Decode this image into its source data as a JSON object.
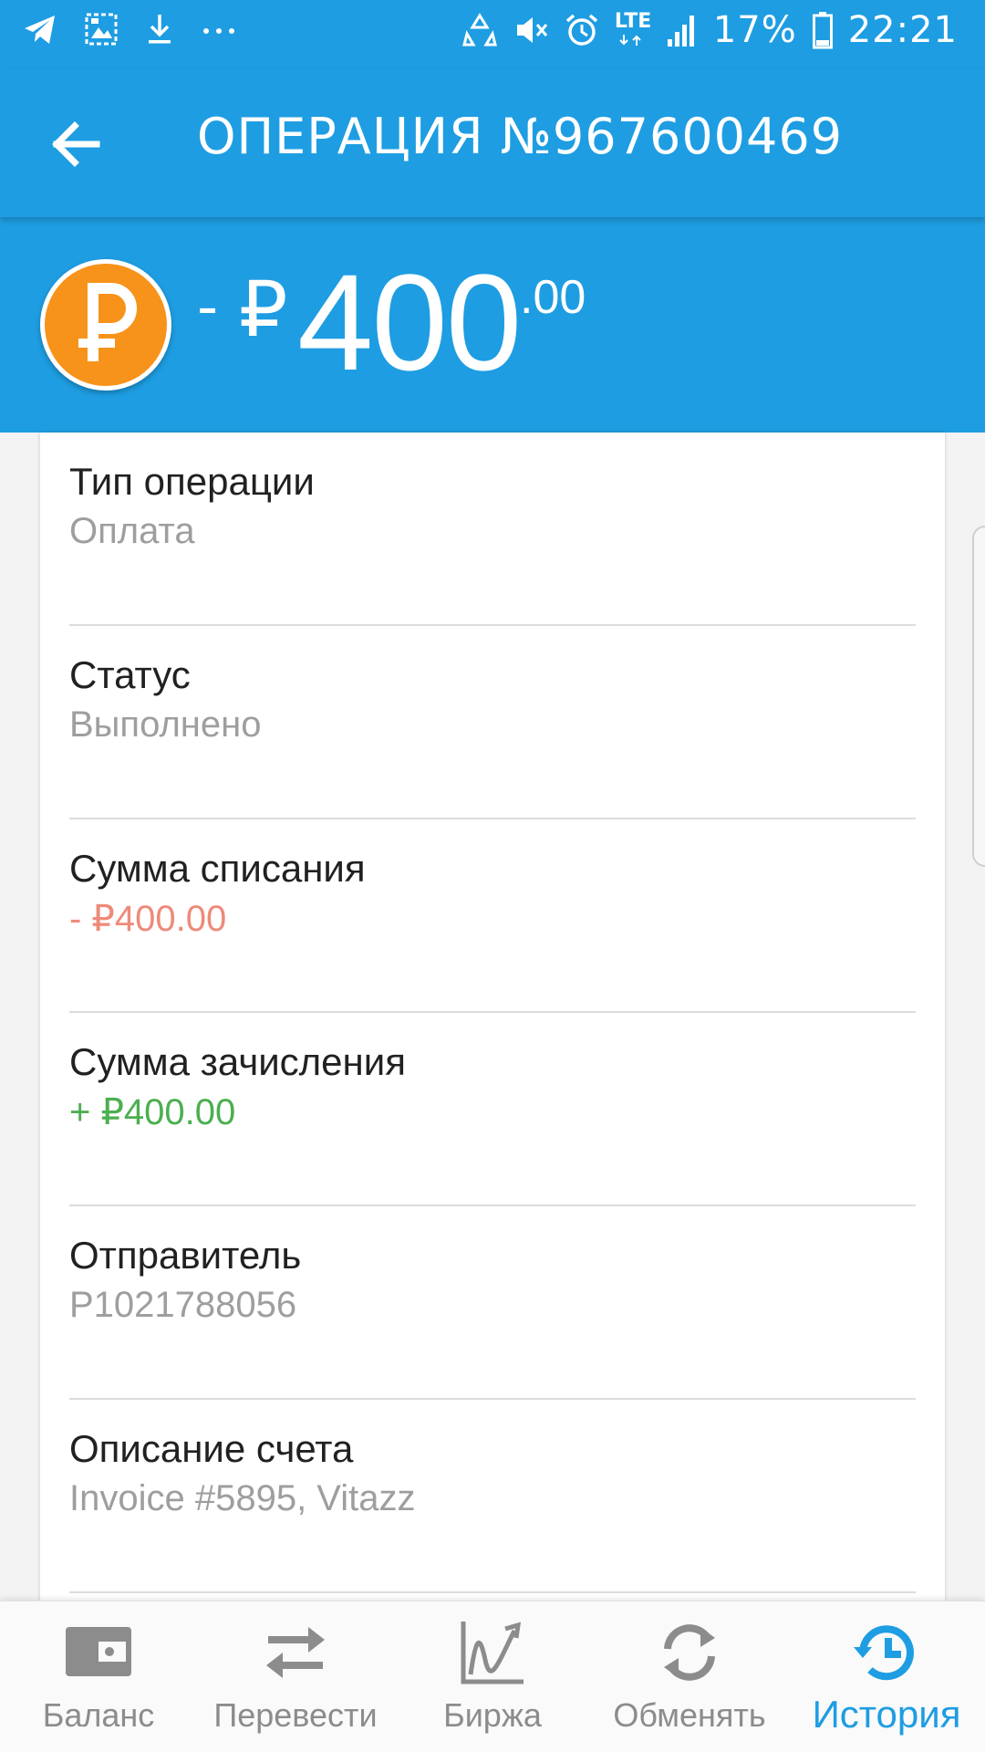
{
  "status_bar": {
    "left_icons": [
      "telegram-icon",
      "gallery-icon",
      "download-icon",
      "more-dots-icon"
    ],
    "right_icons": [
      "data-saver-icon",
      "mute-icon",
      "alarm-icon",
      "lte-icon",
      "signal-icon",
      "battery-icon"
    ],
    "network_label": "LTE",
    "battery_percent": "17%",
    "time": "22:21"
  },
  "header": {
    "title": "ОПЕРАЦИЯ №967600469",
    "back_icon": "arrow-left-icon"
  },
  "amount": {
    "sign": "-",
    "currency_symbol": "₽",
    "whole": "400",
    "fraction": ".00",
    "avatar_icon": "ruble-coin-icon",
    "avatar_color": "#f7931a"
  },
  "details": [
    {
      "label": "Тип операции",
      "value": "Оплата",
      "tone": "neutral"
    },
    {
      "label": "Статус",
      "value": "Выполнено",
      "tone": "neutral"
    },
    {
      "label": "Сумма списания",
      "value": "- ₽400.00",
      "tone": "negative"
    },
    {
      "label": "Сумма зачисления",
      "value": "+ ₽400.00",
      "tone": "positive"
    },
    {
      "label": "Отправитель",
      "value": "P1021788056",
      "tone": "neutral"
    },
    {
      "label": "Описание счета",
      "value": "Invoice #5895, Vitazz",
      "tone": "neutral"
    }
  ],
  "bottom_nav": {
    "items": [
      {
        "label": "Баланс",
        "icon": "wallet-icon",
        "active": false
      },
      {
        "label": "Перевести",
        "icon": "transfer-arrows-icon",
        "active": false
      },
      {
        "label": "Биржа",
        "icon": "chart-icon",
        "active": false
      },
      {
        "label": "Обменять",
        "icon": "exchange-refresh-icon",
        "active": false
      },
      {
        "label": "История",
        "icon": "history-icon",
        "active": true
      }
    ]
  },
  "colors": {
    "primary": "#1e9de2",
    "negative": "#ef8a7a",
    "positive": "#4caf50",
    "muted": "#9e9e9e",
    "nav_inactive": "#8c8c8c"
  }
}
